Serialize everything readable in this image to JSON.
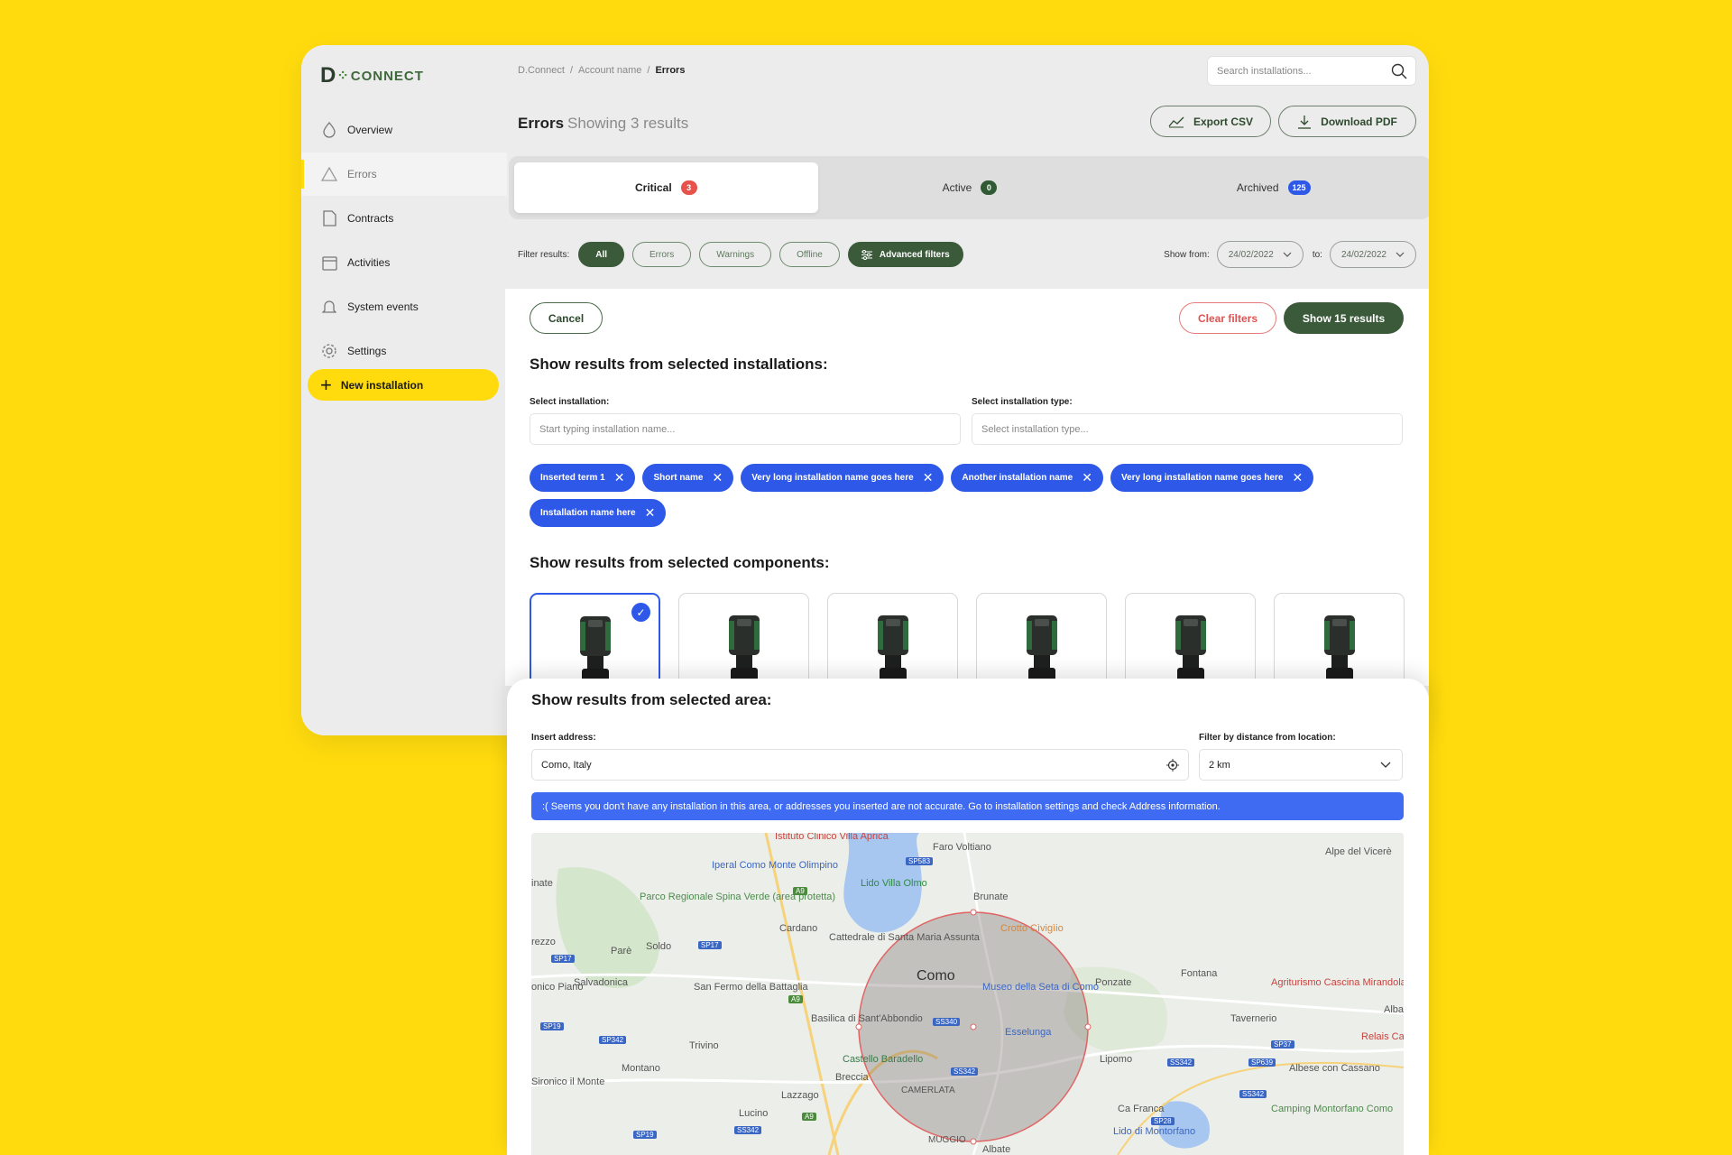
{
  "logo": {
    "text_d": "D",
    "text_rest": "CONNECT"
  },
  "sidebar": {
    "items": [
      {
        "label": "Overview",
        "icon": "drop-icon"
      },
      {
        "label": "Errors",
        "icon": "warning-icon"
      },
      {
        "label": "Contracts",
        "icon": "document-icon"
      },
      {
        "label": "Activities",
        "icon": "calendar-icon"
      },
      {
        "label": "System events",
        "icon": "bell-icon"
      },
      {
        "label": "Settings",
        "icon": "gear-icon"
      }
    ],
    "new_installation": "New installation"
  },
  "breadcrumb": {
    "root": "D.Connect",
    "account": "Account name",
    "current": "Errors",
    "separator": "/"
  },
  "search": {
    "placeholder": "Search installations..."
  },
  "header": {
    "title": "Errors",
    "subtitle": "Showing 3 results",
    "export_csv": "Export CSV",
    "download_pdf": "Download PDF"
  },
  "tabs": [
    {
      "label": "Critical",
      "count": "3",
      "color": "#e5534b"
    },
    {
      "label": "Active",
      "count": "0",
      "color": "#2f5a33"
    },
    {
      "label": "Archived",
      "count": "125",
      "color": "#2e58e8"
    }
  ],
  "filters": {
    "label": "Filter results:",
    "chips": [
      "All",
      "Errors",
      "Warnings",
      "Offline"
    ],
    "advanced": "Advanced filters",
    "show_from_label": "Show from:",
    "from_date": "24/02/2022",
    "to_label": "to:",
    "to_date": "24/02/2022"
  },
  "panel": {
    "cancel": "Cancel",
    "clear_filters": "Clear filters",
    "show_results": "Show 15 results",
    "installations_heading": "Show results from selected installations:",
    "select_installation_label": "Select installation:",
    "select_installation_placeholder": "Start typing installation name...",
    "select_type_label": "Select installation type:",
    "select_type_placeholder": "Select installation type...",
    "tags": [
      "Inserted term 1",
      "Short name",
      "Very long installation name goes here",
      "Another installation name",
      "Very long installation name goes here",
      "Installation name here"
    ],
    "components_heading": "Show results from selected components:"
  },
  "area": {
    "heading": "Show results from selected area:",
    "address_label": "Insert address:",
    "address_value": "Como, Italy",
    "distance_label": "Filter by distance from location:",
    "distance_value": "2 km",
    "alert": ":(   Seems you don't have any installation in this area, or addresses you inserted are not accurate. Go to installation settings and check Address information."
  },
  "map": {
    "labels": [
      "Istituto Clinico Villa Aprica",
      "Faro Voltiano",
      "Alpe del Vicerè",
      "Iperal Como Monte Olimpino",
      "Lido Villa Olmo",
      "Brunate",
      "Parco Regionale Spina Verde (area protetta)",
      "Cardano",
      "Cattedrale di Santa Maria Assunta",
      "Crotto Cìvigìio",
      "Parè",
      "Soldo",
      "Como",
      "Fontana",
      "Salvadonica",
      "San Fermo della Battaglia",
      "Museo della Seta di Como",
      "Ponzate",
      "Agriturismo Cascina Mirandola",
      "Basilica di Sant'Abbondio",
      "Esselunga",
      "Tavernerio",
      "Trivino",
      "Castello Baradello",
      "Lipomo",
      "Montano",
      "Breccia",
      "Albese con Cassano",
      "Lazzago",
      "CAMERLATA",
      "Relais Ca",
      "Lucino",
      "Ca Franca",
      "Camping Montorfano Como",
      "MUGGIO",
      "Lido di Montorfano",
      "Albate",
      "rezzo",
      "onico Piano",
      "inate",
      "Sironico il Monte",
      "Alba"
    ],
    "roads": [
      "SP583",
      "SS340",
      "SP17",
      "SP17",
      "SP19",
      "SS342",
      "SS342",
      "SP37",
      "SP639",
      "SS342",
      "SS342",
      "SP28",
      "SP19",
      "SP342",
      "A9",
      "A9",
      "A9"
    ],
    "colors": {
      "circle_stroke": "#e06666",
      "water": "#a8c7f0",
      "park": "#cfe4c4"
    }
  },
  "colors": {
    "brand_yellow": "#FFDB0E",
    "green": "#3a5a3a",
    "blue": "#2e58e8",
    "red": "#e0524f"
  }
}
